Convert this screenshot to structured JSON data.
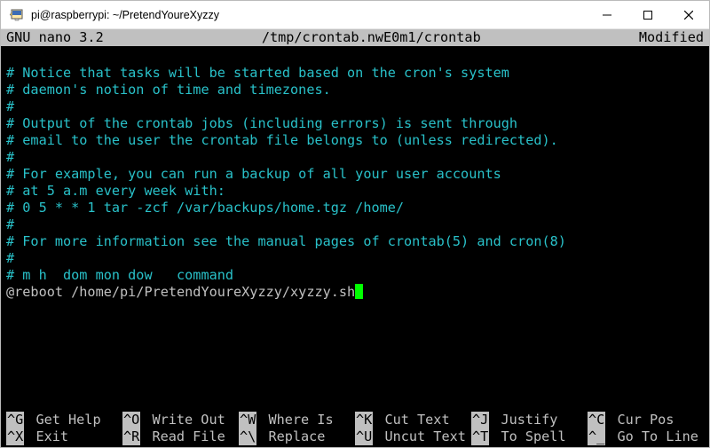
{
  "window": {
    "title": "pi@raspberrypi: ~/PretendYoureXyzzy"
  },
  "nano": {
    "version": "GNU nano 3.2",
    "filepath": "/tmp/crontab.nwE0m1/crontab",
    "status": "Modified"
  },
  "editor_lines": [
    {
      "text": "# Notice that tasks will be started based on the cron's system",
      "comment": true
    },
    {
      "text": "# daemon's notion of time and timezones.",
      "comment": true
    },
    {
      "text": "#",
      "comment": true
    },
    {
      "text": "# Output of the crontab jobs (including errors) is sent through",
      "comment": true
    },
    {
      "text": "# email to the user the crontab file belongs to (unless redirected).",
      "comment": true
    },
    {
      "text": "#",
      "comment": true
    },
    {
      "text": "# For example, you can run a backup of all your user accounts",
      "comment": true
    },
    {
      "text": "# at 5 a.m every week with:",
      "comment": true
    },
    {
      "text": "# 0 5 * * 1 tar -zcf /var/backups/home.tgz /home/",
      "comment": true
    },
    {
      "text": "#",
      "comment": true
    },
    {
      "text": "# For more information see the manual pages of crontab(5) and cron(8)",
      "comment": true
    },
    {
      "text": "#",
      "comment": true
    },
    {
      "text": "# m h  dom mon dow   command",
      "comment": true
    },
    {
      "text": "@reboot /home/pi/PretendYoureXyzzy/xyzzy.sh",
      "comment": false,
      "cursor_after": true
    }
  ],
  "shortcuts": [
    {
      "key": "^G",
      "label": "Get Help"
    },
    {
      "key": "^O",
      "label": "Write Out"
    },
    {
      "key": "^W",
      "label": "Where Is"
    },
    {
      "key": "^K",
      "label": "Cut Text"
    },
    {
      "key": "^J",
      "label": "Justify"
    },
    {
      "key": "^C",
      "label": "Cur Pos"
    },
    {
      "key": "^X",
      "label": "Exit"
    },
    {
      "key": "^R",
      "label": "Read File"
    },
    {
      "key": "^\\",
      "label": "Replace"
    },
    {
      "key": "^U",
      "label": "Uncut Text"
    },
    {
      "key": "^T",
      "label": "To Spell"
    },
    {
      "key": "^_",
      "label": "Go To Line"
    }
  ]
}
